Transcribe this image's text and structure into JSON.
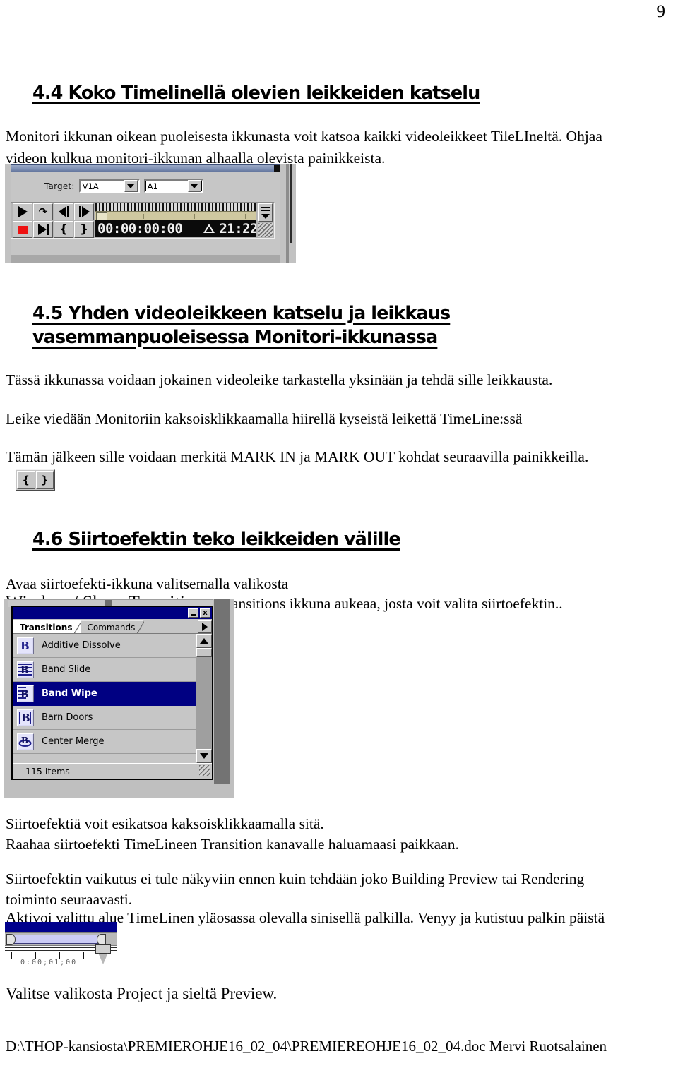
{
  "page": {
    "number": "9"
  },
  "sections": {
    "s44": {
      "heading": "4.4 Koko Timelinellä olevien leikkeiden katselu",
      "paragraph": "Monitori ikkunan oikean puoleisesta ikkunasta voit katsoa kaikki videoleikkeet TileLIneltä. Ohjaa videon kulkua monitori-ikkunan alhaalla olevista painikkeista."
    },
    "s45": {
      "heading_line1": "4.5 Yhden videoleikkeen katselu ja leikkaus",
      "heading_line2": "vasemmanpuoleisessa Monitori-ikkunassa",
      "para1": "Tässä ikkunassa voidaan jokainen videoleike tarkastella yksinään ja tehdä sille leikkausta.",
      "para2": "Leike viedään Monitoriin kaksoisklikkaamalla hiirellä kyseistä leikettä TimeLine:ssä",
      "para3": "Tämän jälkeen sille voidaan merkitä MARK IN ja MARK OUT kohdat seuraavilla painikkeilla."
    },
    "s46": {
      "heading": "4.6 Siirtoefektin teko leikkeiden välille",
      "para1": "Avaa siirtoefekti-ikkuna valitsemalla valikosta",
      "menu_path": "Window / Show Transitions",
      "para2_rest": ". Transitions ikkuna aukeaa, josta voit valita siirtoefektin..",
      "para3": "Siirtoefektiä voit esikatsoa kaksoisklikkaamalla sitä.",
      "para4": "Raahaa siirtoefekti TimeLineen Transition kanavalle haluamaasi paikkaan.",
      "para5a": "Siirtoefektin vaikutus ei tule näkyviin ennen kuin tehdään joko Building Preview tai Rendering",
      "para5b": "toiminto seuraavasti.",
      "para6": "Aktivoi valittu alue TimeLinen yläosassa olevalla sinisellä palkilla. Venyy ja kutistuu palkin päistä",
      "para7": "Valitse valikosta Project  ja sieltä Preview."
    }
  },
  "footer": {
    "path": "D:\\THOP-kansiosta\\PREMIEROHJE16_02_04\\PREMIEREOHJE16_02_04.doc Mervi Ruotsalainen"
  },
  "figures": {
    "monitor_panel": {
      "target_label": "Target:",
      "target_video": "V1A",
      "target_audio": "A1",
      "timecode": "00:00:00:00",
      "duration_delta": "21:22",
      "buttons": [
        {
          "name": "play-button",
          "glyph": "play"
        },
        {
          "name": "loop-button",
          "glyph": "loop"
        },
        {
          "name": "step-back-button",
          "glyph": "step-back"
        },
        {
          "name": "step-forward-button",
          "glyph": "step-forward"
        },
        {
          "name": "stop-button",
          "glyph": "stop"
        },
        {
          "name": "play-to-out-button",
          "glyph": "play-to-out"
        },
        {
          "name": "mark-in-button",
          "glyph": "{"
        },
        {
          "name": "mark-out-button",
          "glyph": "}"
        }
      ]
    },
    "mark_buttons": {
      "mark_in": "{",
      "mark_out": "}"
    },
    "transitions_window": {
      "tabs": [
        {
          "label": "Transitions",
          "active": true
        },
        {
          "label": "Commands",
          "active": false
        }
      ],
      "items": [
        {
          "label": "Additive Dissolve",
          "selected": false
        },
        {
          "label": "Band Slide",
          "selected": false
        },
        {
          "label": "Band Wipe",
          "selected": true
        },
        {
          "label": "Barn Doors",
          "selected": false
        },
        {
          "label": "Center Merge",
          "selected": false
        }
      ],
      "status": "115 Items",
      "minimize_label": "",
      "close_label": "x",
      "title_bar_color": "#000082",
      "selection_color": "#000082"
    },
    "timeline_bar": {
      "timecode_hint": "0:00;01;00"
    }
  }
}
